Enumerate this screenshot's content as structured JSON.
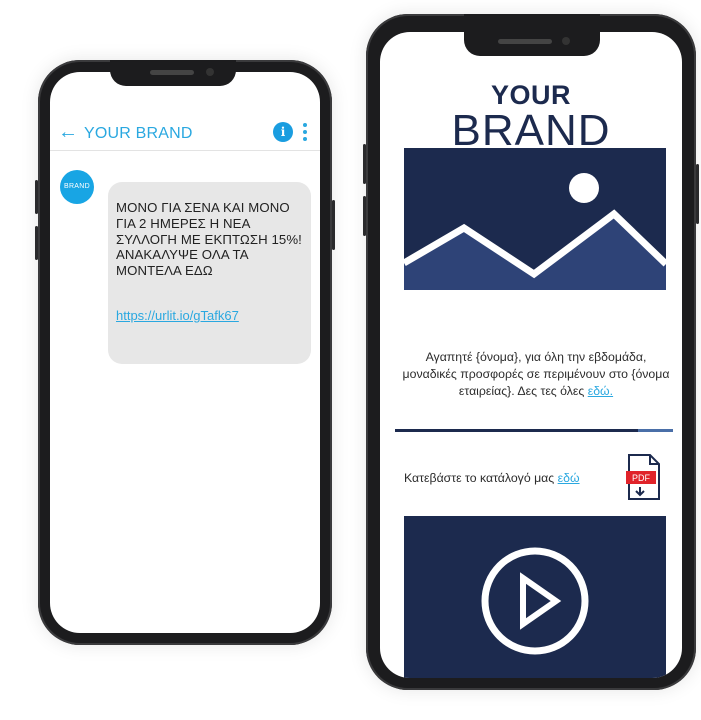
{
  "sms": {
    "back_icon": "arrow-left-icon",
    "title": "YOUR BRAND",
    "info_icon_label": "i",
    "avatar_label": "BRAND",
    "message": "ΜΟΝΟ ΓΙΑ ΣΕΝΑ ΚΑΙ ΜΟΝΟ ΓΙΑ 2 ΗΜΕΡΕΣ Η ΝΕΑ ΣΥΛΛΟΓΗ ΜΕ ΕΚΠΤΩΣΗ 15%! ΑΝΑΚΑΛΥΨΕ ΟΛΑ ΤΑ ΜΟΝΤΕΛΑ ΕΔΩ",
    "link": "https://urlit.io/gTafk67"
  },
  "email": {
    "brand_line1": "YOUR",
    "brand_line2": "BRAND",
    "body": "Αγαπητέ {όνομα}, για όλη την εβδομάδα, μοναδικές προσφορές σε περιμένουν στο {όνομα εταιρείας}. Δες τες όλες",
    "body_link": "εδώ.",
    "catalog_text": "Κατεβάστε το κατάλογό μας",
    "catalog_link": "εδώ",
    "pdf_label": "PDF"
  },
  "colors": {
    "accent": "#2aa8e0",
    "navy": "#1c2a4e",
    "bubble": "#e7e7e7",
    "pdf_red": "#e0232a"
  }
}
